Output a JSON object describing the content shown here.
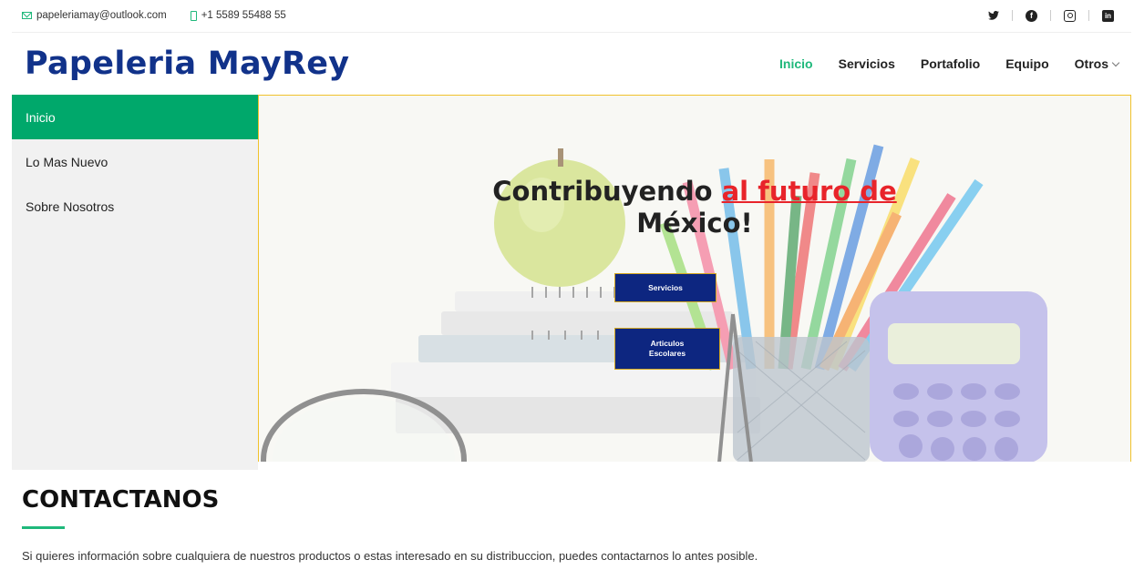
{
  "topbar": {
    "email": "papeleriamay@outlook.com",
    "phone": "+1 5589 55488 55",
    "social": [
      "twitter-icon",
      "facebook-icon",
      "instagram-icon",
      "linkedin-icon"
    ]
  },
  "brand": {
    "name": "Papeleria MayRey",
    "color": "#11328a"
  },
  "nav": {
    "items": [
      "Inicio",
      "Servicios",
      "Portafolio",
      "Equipo",
      "Otros"
    ],
    "active": "Inicio",
    "accent": "#1fb87b"
  },
  "sidebar": {
    "items": [
      "Inicio",
      "Lo Mas Nuevo",
      "Sobre Nosotros"
    ],
    "active_color": "#00a86b"
  },
  "hero": {
    "title_part1": "Contribuyendo ",
    "title_highlight": "al futuro de",
    "title_part2": "México!",
    "button1": "Servicios",
    "button2_line1": "Articulos",
    "button2_line2": "Escolares"
  },
  "contact": {
    "title": "CONTACTANOS",
    "text": "Si quieres información sobre cualquiera de nuestros productos o estas interesado en su distribuccion, puedes contactarnos lo antes posible."
  }
}
